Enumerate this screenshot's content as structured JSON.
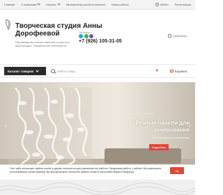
{
  "topnav": {
    "items": [
      {
        "label": "Главная",
        "has_dropdown": false
      },
      {
        "label": "О компании",
        "has_dropdown": true
      },
      {
        "label": "Каталог",
        "has_dropdown": true
      },
      {
        "label": "Калькулятор расчёта панелей",
        "has_dropdown": false
      },
      {
        "label": "Наши работы",
        "has_dropdown": false
      }
    ],
    "right": [
      {
        "label": "Войти",
        "icon": "user-icon"
      },
      {
        "label": "Регистрация",
        "icon": null
      }
    ]
  },
  "header": {
    "brand_title": "Творческая студия Анны Дорофеевой",
    "brand_desc": "Производство резных панелей, решеток и перегородок. Оформление интерьеров.",
    "phone_label": "Телефон",
    "phone": "+7 (926) 105-31-05",
    "messengers": [
      {
        "icon": "telegram-icon",
        "color": "#2aa3df"
      },
      {
        "icon": "whatsapp-icon",
        "color": "#34b94a"
      },
      {
        "icon": "viber-icon",
        "color": "#7b519d"
      }
    ],
    "compare_label": "Сравнение"
  },
  "search": {
    "catalog_label": "Каталог товаров",
    "placeholder": "Найти товар",
    "favorites_label": "",
    "cart_label": "Корзина"
  },
  "hero": {
    "subtitle": "Сделано с любовью",
    "title": "Резные панели для зонирования",
    "description": "Резные панели в интерьере",
    "button_label": "Подробнее"
  },
  "cookie": {
    "text": "Этот сайт использует файлы cookie и другие технологии для улучшения его работы. Продолжая работу с сайтом, Вы разрешаете использование cookie-файлов. Вы всегда можете отключить файлы cookie в настройках Вашего браузера.",
    "button_label": "Ок"
  },
  "colors": {
    "accent": "#e0463a",
    "dark": "#2b2b2b",
    "topbar": "#f3f3f3"
  }
}
